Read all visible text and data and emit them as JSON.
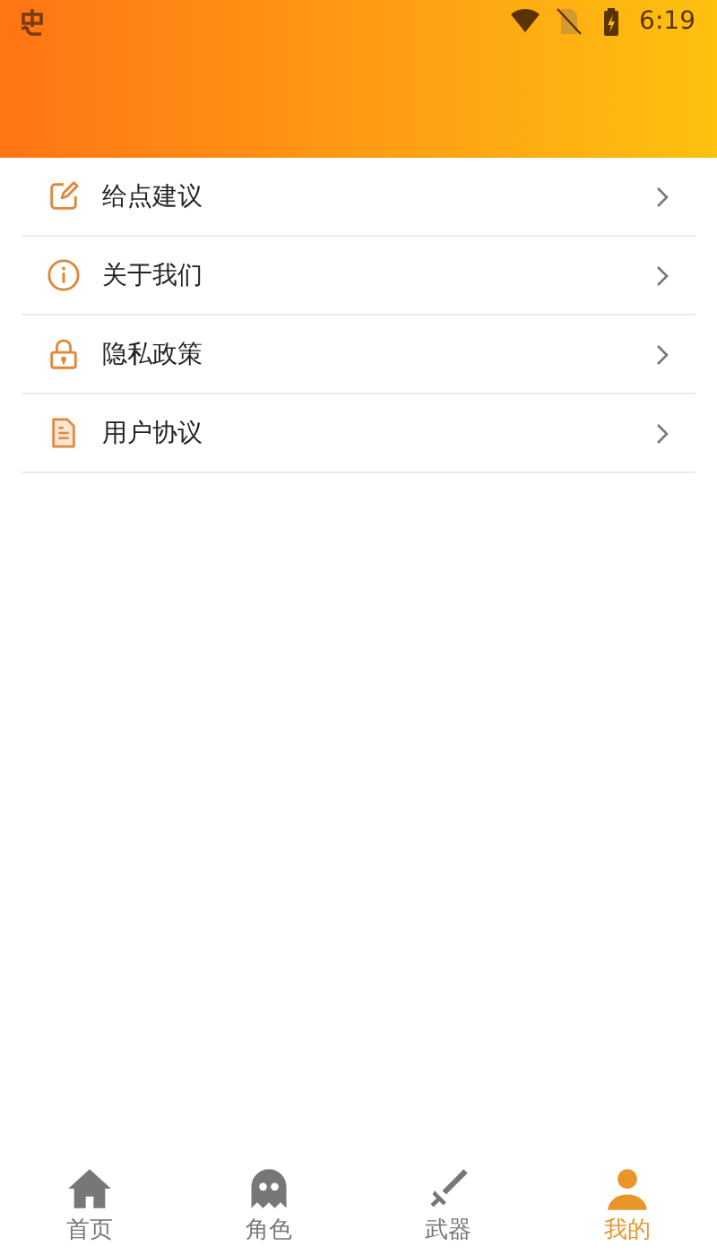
{
  "status_bar": {
    "time": "6:19"
  },
  "menu": [
    {
      "kind": "edit",
      "label": "给点建议"
    },
    {
      "kind": "info",
      "label": "关于我们"
    },
    {
      "kind": "lock",
      "label": "隐私政策"
    },
    {
      "kind": "document",
      "label": "用户协议"
    }
  ],
  "tabs": [
    {
      "kind": "home",
      "label": "首页",
      "selected": false
    },
    {
      "kind": "ghost",
      "label": "角色",
      "selected": false
    },
    {
      "kind": "sword",
      "label": "武器",
      "selected": false
    },
    {
      "kind": "person",
      "label": "我的",
      "selected": true
    }
  ]
}
